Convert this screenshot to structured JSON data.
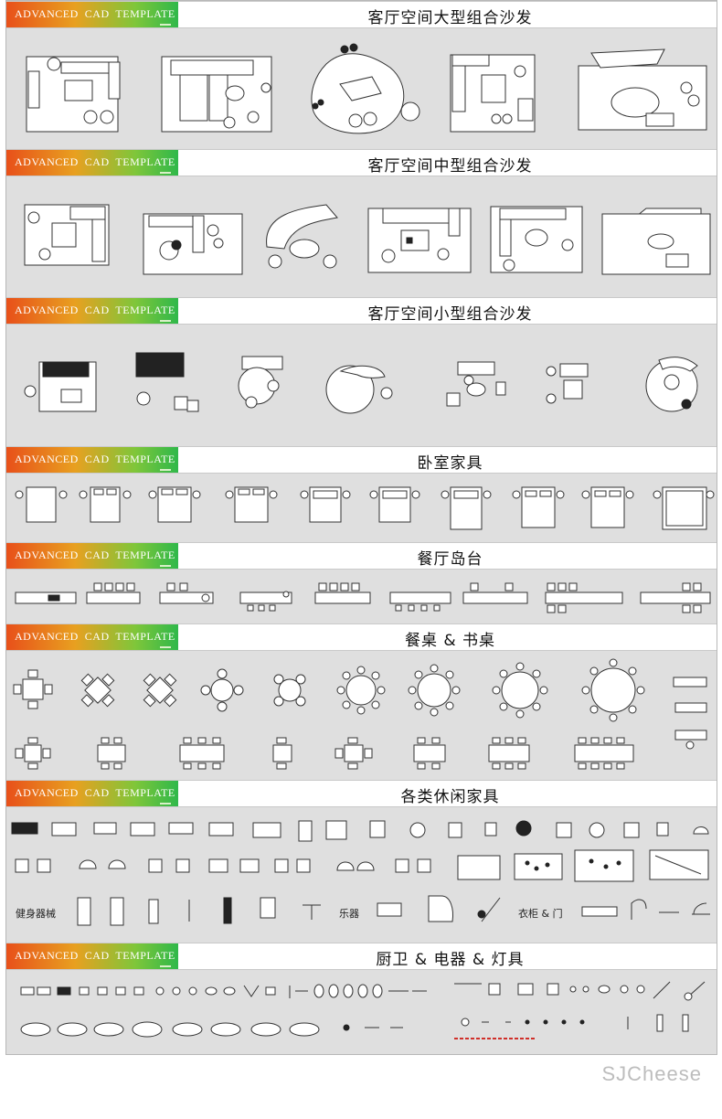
{
  "template_tag": "ADVANCED  CAD  TEMPLATE",
  "sections": [
    {
      "title": "客厅空间大型组合沙发"
    },
    {
      "title": "客厅空间中型组合沙发"
    },
    {
      "title": "客厅空间小型组合沙发"
    },
    {
      "title": "卧室家具"
    },
    {
      "title": "餐厅岛台"
    },
    {
      "title": "餐桌 & 书桌"
    },
    {
      "title": "各类休闲家具"
    },
    {
      "title": "厨卫 & 电器 & 灯具"
    }
  ],
  "labels": {
    "fitness": "健身器械",
    "instruments": "乐器",
    "wardrobe_door": "衣柜 & 门"
  },
  "watermark": "SJCheese",
  "colors": {
    "tag_gradient": [
      "#e8501a",
      "#e8a020",
      "#7fc63a",
      "#2fb84a"
    ],
    "sheet": "#dfdfdf"
  }
}
